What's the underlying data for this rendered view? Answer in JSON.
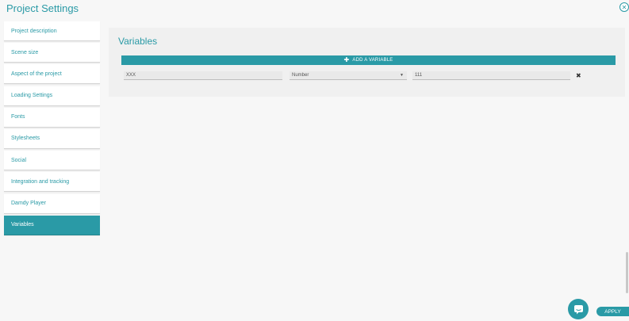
{
  "window": {
    "title": "Project Settings"
  },
  "sidebar": {
    "items": [
      {
        "label": "Project description"
      },
      {
        "label": "Scene size"
      },
      {
        "label": "Aspect of the project"
      },
      {
        "label": "Loading Settings"
      },
      {
        "label": "Fonts"
      },
      {
        "label": "Stylesheets"
      },
      {
        "label": "Social"
      },
      {
        "label": "Integration and tracking"
      },
      {
        "label": "Damdy Player"
      },
      {
        "label": "Variables",
        "active": true
      }
    ]
  },
  "variables": {
    "title": "Variables",
    "add_label": "ADD A VARIABLE",
    "rows": [
      {
        "name": "XXX",
        "type": "Number",
        "value": "111"
      }
    ]
  },
  "footer": {
    "apply_label": "APPLY"
  },
  "icons": {
    "close": "close-icon",
    "plus": "plus-icon",
    "remove": "remove-icon",
    "caret": "caret-down-icon",
    "chat": "chat-icon"
  },
  "colors": {
    "accent": "#2a9aa6",
    "background": "#f7f7f7",
    "panel": "#f0f0f0"
  }
}
